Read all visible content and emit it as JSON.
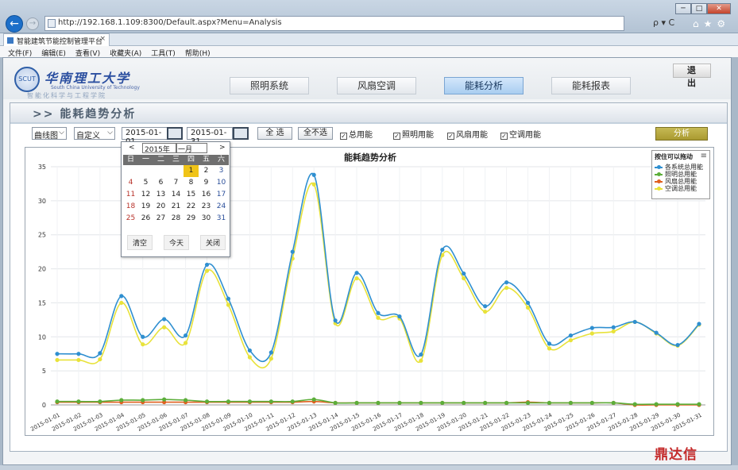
{
  "browser": {
    "url": "http://192.168.1.109:8300/Default.aspx?Menu=Analysis",
    "url_tools": "ρ ▾ C",
    "tab_title": "智能建筑节能控制管理平台",
    "tab_close": "×",
    "win_min": "─",
    "win_max": "□",
    "win_close": "✕",
    "nav_icons": "⌂★⚙",
    "back": "←",
    "forward": "→",
    "menu": [
      "文件(F)",
      "编辑(E)",
      "查看(V)",
      "收藏夹(A)",
      "工具(T)",
      "帮助(H)"
    ]
  },
  "header": {
    "logo_cn": "华南理工大学",
    "logo_en": "South China University of Technology",
    "logo_sub": "智能化科学与工程学院",
    "logout": "退 出",
    "nav": [
      {
        "label": "照明系统",
        "active": false
      },
      {
        "label": "风扇空调",
        "active": false
      },
      {
        "label": "能耗分析",
        "active": true
      },
      {
        "label": "能耗报表",
        "active": false
      }
    ]
  },
  "panel": {
    "title": ">> 能耗趋势分析",
    "chart_type": "曲线图",
    "range_type": "自定义",
    "start_date": "2015-01-01",
    "end_date": "2015-01-31",
    "select_all": "全 选",
    "select_none": "全不选",
    "checks": [
      {
        "label": "总用能",
        "checked": true
      },
      {
        "label": "照明用能",
        "checked": true
      },
      {
        "label": "风扇用能",
        "checked": true
      },
      {
        "label": "空调用能",
        "checked": true
      }
    ],
    "check_mark": "✓",
    "analyze": "分析"
  },
  "calendar": {
    "prev": "<",
    "next": ">",
    "year": "2015年",
    "month": "一月",
    "weekdays": [
      "日",
      "一",
      "二",
      "三",
      "四",
      "五",
      "六"
    ],
    "days": [
      "",
      "",
      "",
      "",
      "1",
      "2",
      "3",
      "4",
      "5",
      "6",
      "7",
      "8",
      "9",
      "10",
      "11",
      "12",
      "13",
      "14",
      "15",
      "16",
      "17",
      "18",
      "19",
      "20",
      "21",
      "22",
      "23",
      "24",
      "25",
      "26",
      "27",
      "28",
      "29",
      "30",
      "31",
      "",
      ""
    ],
    "selected_day": "1",
    "clear": "清空",
    "today": "今天",
    "close": "关闭"
  },
  "legend": {
    "title": "按住可以拖动",
    "menu_icon": "≡"
  },
  "watermark": "鼎达信",
  "chart_data": {
    "type": "line",
    "title": "能耗趋势分析",
    "ylim": [
      0,
      35
    ],
    "yticks": [
      0,
      5,
      10,
      15,
      20,
      25,
      30,
      35
    ],
    "x": [
      "2015-01-01",
      "2015-01-02",
      "2015-01-03",
      "2015-01-04",
      "2015-01-05",
      "2015-01-06",
      "2015-01-07",
      "2015-01-08",
      "2015-01-09",
      "2015-01-10",
      "2015-01-11",
      "2015-01-12",
      "2015-01-13",
      "2015-01-14",
      "2015-01-15",
      "2015-01-16",
      "2015-01-17",
      "2015-01-18",
      "2015-01-19",
      "2015-01-20",
      "2015-01-21",
      "2015-01-22",
      "2015-01-23",
      "2015-01-24",
      "2015-01-25",
      "2015-01-26",
      "2015-01-27",
      "2015-01-28",
      "2015-01-29",
      "2015-01-30",
      "2015-01-31"
    ],
    "series": [
      {
        "name": "各系统总用能",
        "color": "#2f8fd0",
        "values": [
          7.5,
          7.5,
          7.6,
          16,
          10,
          12.6,
          10.2,
          20.6,
          15.6,
          8,
          7.7,
          22.5,
          33.8,
          12.4,
          19.4,
          13.5,
          13,
          7.4,
          22.8,
          19.3,
          14.5,
          18,
          15,
          9,
          10.2,
          11.3,
          11.4,
          12.2,
          10.6,
          8.8,
          11.9
        ]
      },
      {
        "name": "照明总用能",
        "color": "#5cae3a",
        "values": [
          0.5,
          0.5,
          0.5,
          0.7,
          0.7,
          0.8,
          0.7,
          0.5,
          0.5,
          0.5,
          0.5,
          0.5,
          0.8,
          0.3,
          0.3,
          0.3,
          0.3,
          0.3,
          0.3,
          0.3,
          0.3,
          0.3,
          0.3,
          0.3,
          0.3,
          0.3,
          0.3,
          0.1,
          0.1,
          0.1,
          0.1
        ]
      },
      {
        "name": "风扇总用能",
        "color": "#e0601f",
        "values": [
          0.4,
          0.4,
          0.4,
          0.4,
          0.4,
          0.4,
          0.4,
          0.4,
          0.4,
          0.4,
          0.4,
          0.4,
          0.5,
          0.3,
          0.3,
          0.3,
          0.3,
          0.3,
          0.3,
          0.3,
          0.3,
          0.3,
          0.4,
          0.3,
          0.3,
          0.3,
          0.3,
          0.0,
          0.0,
          0.0,
          0.0
        ]
      },
      {
        "name": "空调总用能",
        "color": "#e8e23a",
        "values": [
          6.6,
          6.6,
          6.7,
          15,
          8.9,
          11.4,
          9.1,
          19.7,
          14.7,
          7,
          6.8,
          21.5,
          32.4,
          12,
          18.6,
          12.8,
          12.7,
          6.5,
          22,
          18.6,
          13.7,
          17.2,
          14.3,
          8.3,
          9.5,
          10.5,
          10.8,
          12.2,
          10.5,
          8.7,
          11.8
        ]
      }
    ]
  }
}
